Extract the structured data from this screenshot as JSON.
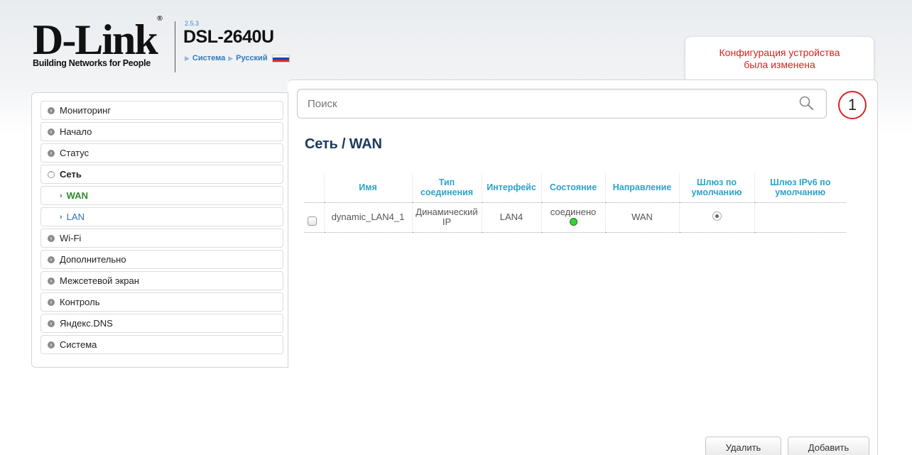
{
  "header": {
    "logo_text": "D-Link",
    "logo_tagline": "Building Networks for People",
    "version": "2.5.3",
    "model": "DSL-2640U",
    "crumbs": [
      "Система",
      "Русский"
    ]
  },
  "notification": {
    "line1": "Конфигурация устройства",
    "line2": "была изменена",
    "count": "1"
  },
  "search": {
    "placeholder": "Поиск"
  },
  "sidebar": {
    "items": [
      {
        "label": "Мониторинг"
      },
      {
        "label": "Начало"
      },
      {
        "label": "Статус"
      },
      {
        "label": "Сеть",
        "expanded": true,
        "children": [
          {
            "label": "WAN",
            "active": true
          },
          {
            "label": "LAN"
          }
        ]
      },
      {
        "label": "Wi-Fi"
      },
      {
        "label": "Дополнительно"
      },
      {
        "label": "Межсетевой экран"
      },
      {
        "label": "Контроль"
      },
      {
        "label": "Яндекс.DNS"
      },
      {
        "label": "Система"
      }
    ]
  },
  "page": {
    "title": "Сеть /  WAN"
  },
  "table": {
    "headers": {
      "name": "Имя",
      "type": "Тип соединения",
      "iface": "Интерфейс",
      "state": "Состояние",
      "direction": "Направление",
      "gw": "Шлюз по умолчанию",
      "gw6": "Шлюз IPv6 по умолчанию"
    },
    "rows": [
      {
        "name": "dynamic_LAN4_1",
        "type": "Динамический IP",
        "iface": "LAN4",
        "state": "соединено",
        "direction": "WAN",
        "gw_selected": true,
        "gw6": ""
      }
    ]
  },
  "buttons": {
    "delete": "Удалить",
    "add": "Добавить"
  }
}
